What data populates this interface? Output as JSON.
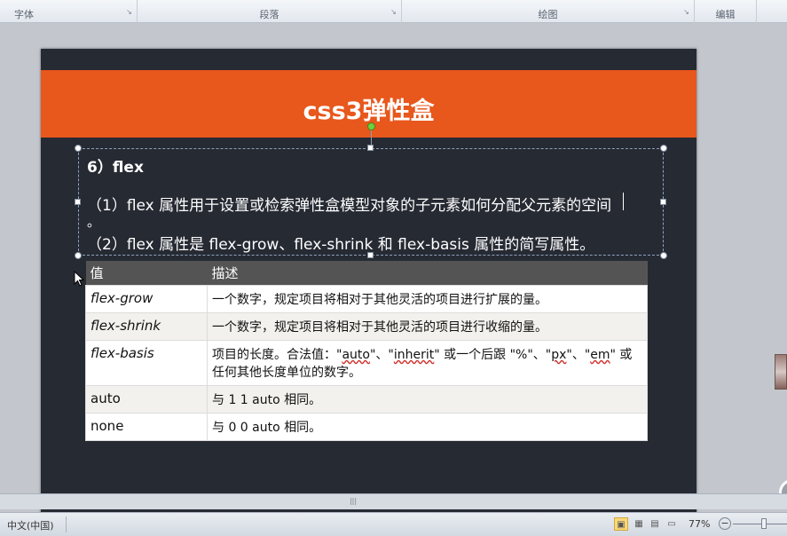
{
  "ribbon": {
    "groups": [
      {
        "label": "字体"
      },
      {
        "label": "段落"
      },
      {
        "label": "绘图"
      },
      {
        "label": "编辑"
      }
    ]
  },
  "slide": {
    "title": "css3弹性盒",
    "heading": "6）flex",
    "line1": "（1）flex 属性用于设置或检索弹性盒模型对象的子元素如何分配父元素的空间",
    "line1_dot": "。",
    "line2": "（2）flex 属性是 flex-grow、flex-shrink 和 flex-basis 属性的简写属性。",
    "table": {
      "headers": [
        "值",
        "描述"
      ],
      "rows": [
        {
          "value": "flex-grow",
          "desc": "一个数字，规定项目将相对于其他灵活的项目进行扩展的量。"
        },
        {
          "value": "flex-shrink",
          "desc": "一个数字，规定项目将相对于其他灵活的项目进行收缩的量。"
        },
        {
          "value": "flex-basis",
          "desc_a": "项目的长度。合法值：\"",
          "desc_auto": "auto",
          "desc_b": "\"、\"",
          "desc_inherit": "inherit",
          "desc_c": "\" 或一个后跟 \"%\"、\"",
          "desc_px": "px",
          "desc_d": "\"、\"",
          "desc_em": "em",
          "desc_e": "\" 或任何其他长度单位的数字。"
        },
        {
          "value": "auto",
          "desc": "与 1 1 auto 相同。"
        },
        {
          "value": "none",
          "desc": "与 0 0 auto 相同。"
        }
      ]
    }
  },
  "status": {
    "language": "中文(中国)",
    "zoom": "77%"
  },
  "colors": {
    "title_bar": "#e8571c",
    "slide_bg": "#262a33",
    "table_header": "#545454"
  },
  "icons": {
    "normal_view": "normal-view-icon",
    "slide_sorter": "slide-sorter-icon",
    "reading_view": "reading-view-icon",
    "slideshow": "slideshow-icon"
  }
}
